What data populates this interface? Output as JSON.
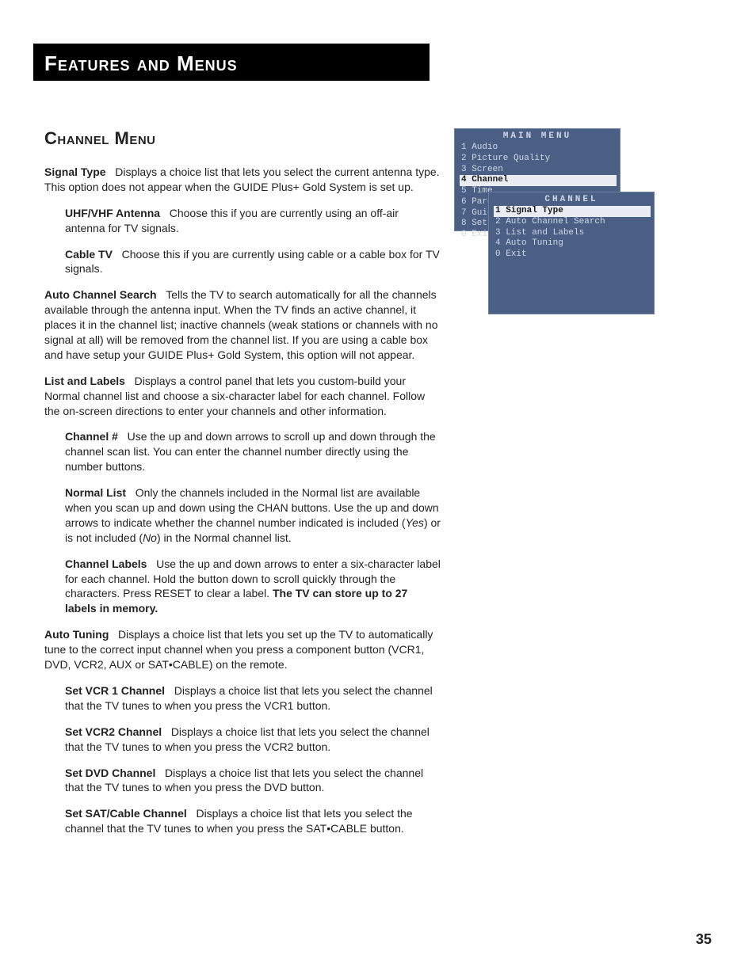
{
  "page_number": "35",
  "chapter_title": "Features and Menus",
  "section_title": "Channel Menu",
  "entries": [
    {
      "level": 0,
      "term": "Signal Type",
      "body": "Displays a choice list that lets you select the current antenna type. This option does not appear when the GUIDE Plus+ Gold System is set up."
    },
    {
      "level": 1,
      "term": "UHF/VHF Antenna",
      "body": "Choose this if you are currently using an off-air antenna for TV signals."
    },
    {
      "level": 1,
      "term": "Cable TV",
      "body": "Choose this if you are currently using cable or a cable box for TV signals."
    },
    {
      "level": 0,
      "term": "Auto Channel Search",
      "body": "Tells the TV to search automatically for all the channels available through the antenna input. When the TV finds an active channel, it places it in the channel list; inactive channels (weak stations or channels with no signal at all) will be removed from the channel list. If you are using a cable box and have setup your GUIDE Plus+ Gold System, this option will not appear."
    },
    {
      "level": 0,
      "term": "List and Labels",
      "body": "Displays a control panel that lets you custom-build your Normal channel list and choose a six-character label for each channel. Follow the on-screen directions to enter your channels and other information."
    },
    {
      "level": 1,
      "term": "Channel #",
      "body": "Use the up and down arrows to scroll up and down through the channel scan list. You can enter the channel number directly using the number buttons."
    },
    {
      "level": 1,
      "term": "Normal List",
      "body_html": "Only the channels included in the Normal list are available when you scan up and down using the CHAN buttons. Use the up and down arrows to indicate whether the channel number indicated is included (<span class=\"em-ital\">Yes</span>) or is not included (<span class=\"em-ital\">No</span>) in the Normal channel list."
    },
    {
      "level": 1,
      "term": "Channel Labels",
      "body_html": "Use the up and down arrows to enter a six-character label for each channel. Hold the button down to scroll quickly through the characters. Press RESET to clear a label. <span class=\"em-bold\">The TV can store up to 27 labels in memory.</span>"
    },
    {
      "level": 0,
      "term": "Auto Tuning",
      "body": "Displays a choice list that lets you set up the TV to automatically tune to the correct input channel when you press a component button (VCR1, DVD, VCR2, AUX or SAT•CABLE) on the remote."
    },
    {
      "level": 1,
      "term": "Set VCR 1 Channel",
      "body": "Displays a choice list that lets you select the channel that the TV tunes to when you press the VCR1 button."
    },
    {
      "level": 1,
      "term": "Set VCR2 Channel",
      "body": "Displays a choice list that lets you select the channel that the TV tunes to when you press the VCR2 button."
    },
    {
      "level": 1,
      "term": "Set DVD Channel",
      "body": "Displays a choice list that lets you select the channel that the TV tunes to when you press the DVD button."
    },
    {
      "level": 1,
      "term": "Set SAT/Cable Channel",
      "body": "Displays a choice list that lets you select the channel that the TV tunes to when you press the SAT•CABLE button."
    }
  ],
  "osd": {
    "main": {
      "title": "MAIN MENU",
      "items": [
        {
          "n": "1",
          "label": "Audio"
        },
        {
          "n": "2",
          "label": "Picture Quality"
        },
        {
          "n": "3",
          "label": "Screen"
        },
        {
          "n": "4",
          "label": "Channel",
          "selected": true
        },
        {
          "n": "5",
          "label": "Time"
        },
        {
          "n": "6",
          "label": "Parental Controls"
        },
        {
          "n": "7",
          "label": "Guide"
        },
        {
          "n": "8",
          "label": "Setup"
        },
        {
          "n": "0",
          "label": "Exit"
        }
      ]
    },
    "sub": {
      "title": "CHANNEL",
      "items": [
        {
          "n": "1",
          "label": "Signal Type",
          "selected": true
        },
        {
          "n": "2",
          "label": "Auto Channel Search"
        },
        {
          "n": "3",
          "label": "List and Labels"
        },
        {
          "n": "4",
          "label": "Auto Tuning"
        },
        {
          "n": "0",
          "label": "Exit"
        }
      ]
    }
  }
}
